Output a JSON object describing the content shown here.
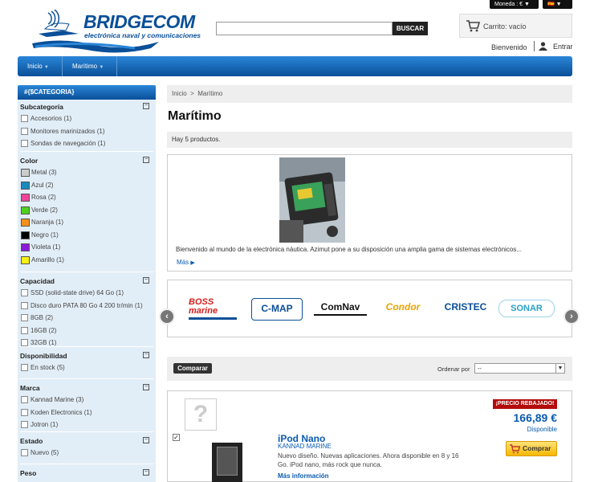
{
  "header": {
    "currency_label": "Moneda : € ▼",
    "language_flag": "🇪🇸 ▼",
    "logo_title": "BRIDGECOM",
    "logo_subtitle": "electrónica naval y comunicaciones",
    "search_placeholder": "",
    "search_button": "BUSCAR",
    "cart_text": "Carrito: vacío",
    "welcome": "Bienvenido",
    "login": "Entrar"
  },
  "nav": {
    "items": [
      "Inicio",
      "Marítimo"
    ]
  },
  "sidebar": {
    "heading": "#{$CATEGORIA}",
    "sections": [
      {
        "title": "Subcategoría",
        "options": [
          "Accesorios (1)",
          "Monitores marinizados (1)",
          "Sondas de navegación (1)"
        ]
      },
      {
        "title": "Color",
        "options": [
          "Metal (3)",
          "Azul (2)",
          "Rosa (2)",
          "Verde (2)",
          "Naranja (1)",
          "Negro (1)",
          "Violeta (1)",
          "Amarillo (1)"
        ],
        "swatches": [
          "#cccccc",
          "#1a8abf",
          "#f0469a",
          "#4fd11f",
          "#f5911d",
          "#000000",
          "#8b1bd9",
          "#f7f014"
        ]
      },
      {
        "title": "Capacidad",
        "options": [
          "SSD (solid-state drive) 64 Go (1)",
          "Disco duro PATA 80 Go 4 200 tr/min (1)",
          "8GB (2)",
          "16GB (2)",
          "32GB (1)"
        ]
      },
      {
        "title": "Disponibilidad",
        "options": [
          "En stock (5)"
        ]
      },
      {
        "title": "Marca",
        "options": [
          "Kannad Marine (3)",
          "Koden Electronics (1)",
          "Jotron (1)"
        ]
      },
      {
        "title": "Estado",
        "options": [
          "Nuevo (5)"
        ]
      },
      {
        "title": "Peso",
        "options": []
      }
    ],
    "collapse_symbol": "−"
  },
  "main": {
    "breadcrumb_home": "Inicio",
    "breadcrumb_sep": ">",
    "breadcrumb_current": "Marítimo",
    "title": "Marítimo",
    "count": "Hay 5 productos.",
    "description": "Bienvenido al mundo de la electrónica náutica. Azimut pone a su disposición una amplia gama de sistemas electrónicos...",
    "more": "Más",
    "brands": [
      "BOSS marine",
      "C-MAP",
      "ComNav",
      "Condor",
      "CRISTEC",
      "SONAR"
    ],
    "compare_button": "Comparar",
    "sort_label": "Ordenar por",
    "sort_value": "--"
  },
  "product": {
    "name": "iPod Nano",
    "brand": "KANNAD MARINE",
    "description": "Nuevo diseño. Nuevas aplicaciones. Ahora disponible en 8 y 16 Go. iPod nano, más rock que nunca.",
    "more_info": "Más información",
    "badge": "¡PRECIO REBAJADO!",
    "price": "166,89 €",
    "availability": "Disponible",
    "buy_button": "Comprar"
  }
}
